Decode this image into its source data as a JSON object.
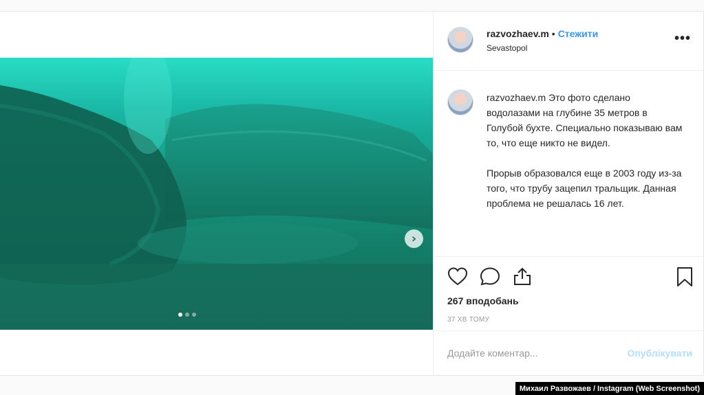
{
  "post": {
    "username": "razvozhaev.m",
    "separator": "•",
    "follow_label": "Стежити",
    "location": "Sevastopol",
    "more_label": "•••",
    "caption": "Это фото сделано водолазами на глубине 35 метров в Голубой бухте. Специально показываю вам то, что еще никто не видел.\n\nПрорыв образовался еще в 2003 году из-за того, что трубу зацепил тральщик. Данная проблема не решалась 16 лет.",
    "likes": "267 вподобань",
    "timestamp": "37 ХВ ТОМУ",
    "comment_placeholder": "Додайте коментар...",
    "publish_label": "Опублікувати",
    "carousel": {
      "next_label": "›",
      "slides": 3,
      "active_slide": 1
    }
  },
  "icons": [
    "heart-icon",
    "comment-icon",
    "share-icon",
    "bookmark-icon",
    "chevron-right-icon"
  ],
  "colors": {
    "link": "#3897f0",
    "publish_disabled": "#b2dffc",
    "water": "#18b8a6"
  },
  "credit": "Михаил Развожаев / Instagram (Web Screenshot)"
}
